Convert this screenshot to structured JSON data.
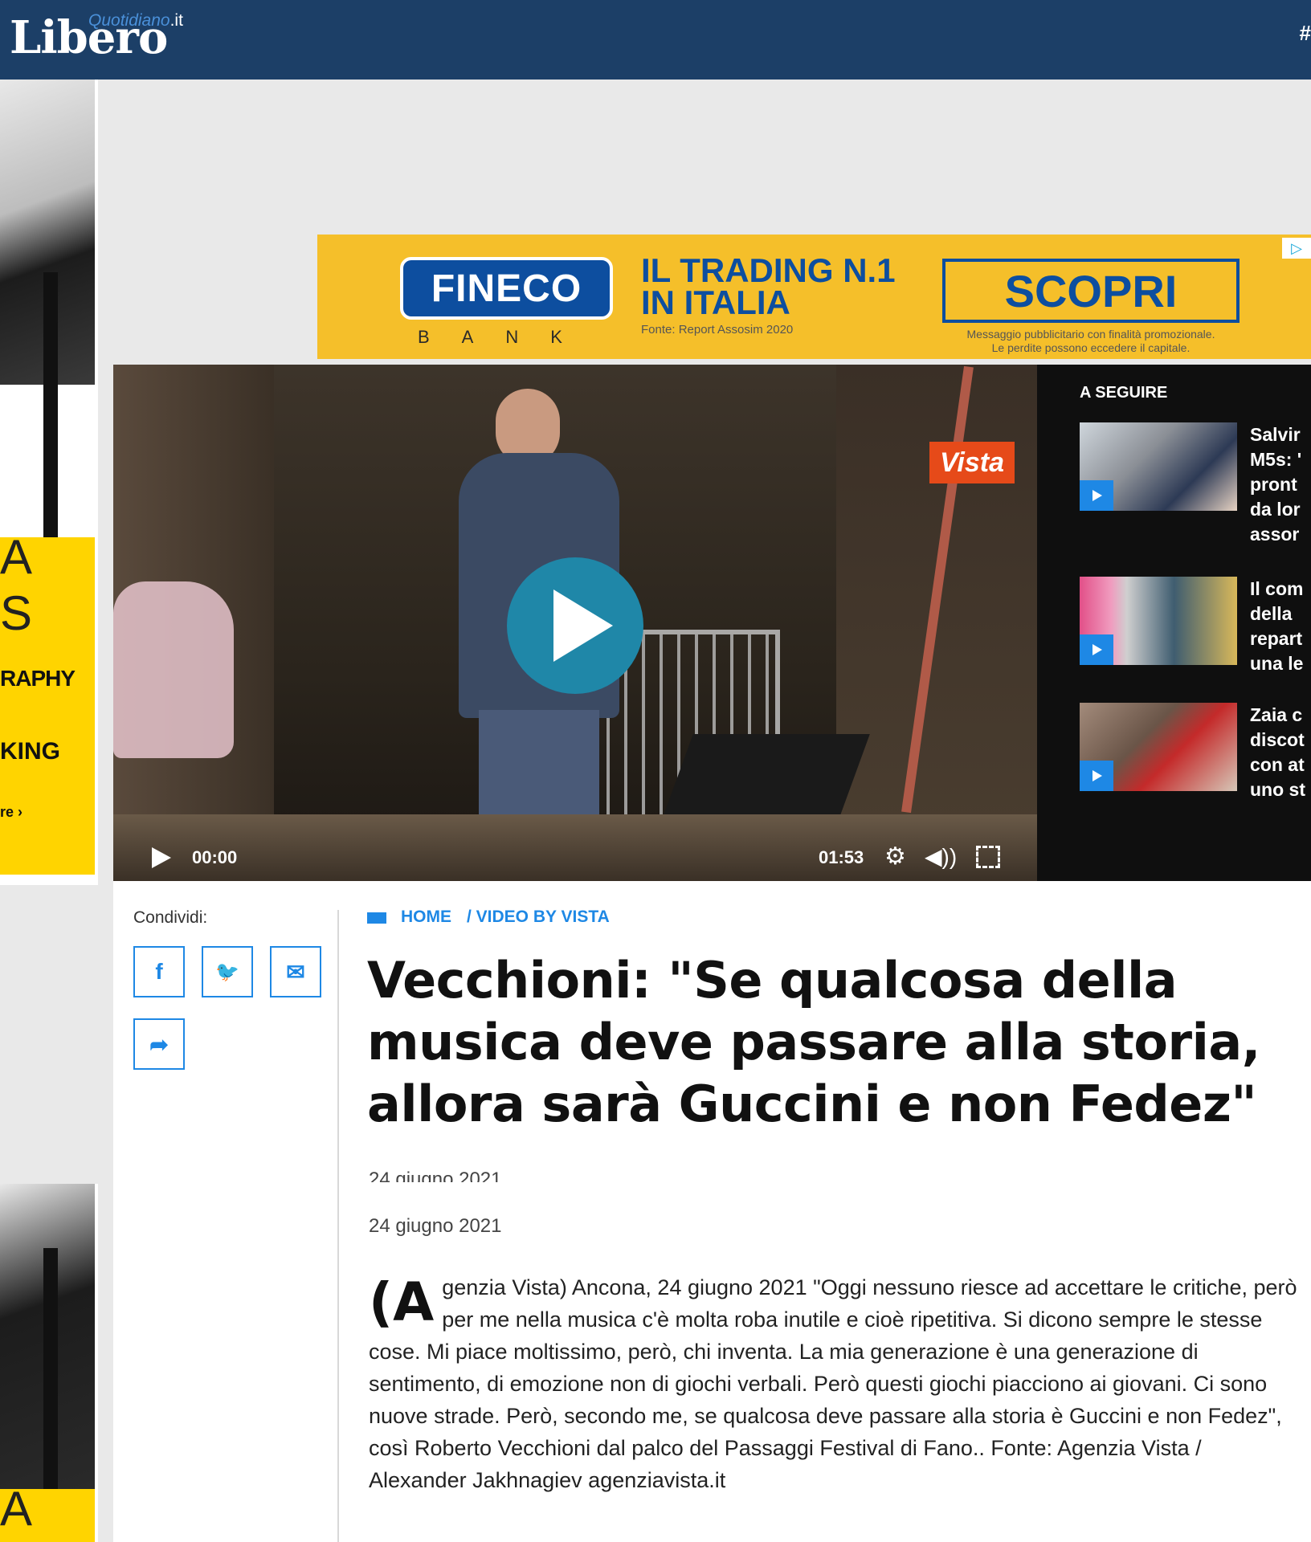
{
  "header": {
    "logo_main": "Libero",
    "logo_sub": "Quotidiano",
    "logo_tld": ".it",
    "right_glyph": "#"
  },
  "left_skin": {
    "letter_a": "A",
    "letter_s": "S",
    "text_graphy": "RAPHY",
    "text_king": "KING",
    "text_more": "re ›"
  },
  "ad": {
    "brand": "FINECO",
    "brand_sub": "BANK",
    "headline_1": "IL TRADING N.1",
    "headline_2": "IN ITALIA",
    "source": "Fonte: Report Assosim 2020",
    "cta": "SCOPRI",
    "disclaimer_1": "Messaggio pubblicitario con finalità promozionale.",
    "disclaimer_2": "Le perdite possono eccedere il capitale.",
    "adchoices_icon": "adchoices-icon"
  },
  "video": {
    "watermark": "Vista",
    "current_time": "00:00",
    "duration": "01:53",
    "settings_icon": "gear-icon",
    "volume_icon": "volume-icon",
    "fullscreen_icon": "fullscreen-icon"
  },
  "up_next": {
    "title": "A SEGUIRE",
    "items": [
      {
        "text": "Salvir\nM5s: '\npront\nda lor\nassor"
      },
      {
        "text": "Il com\ndella \nrepart\nuna le"
      },
      {
        "text": "Zaia c\ndiscot\ncon at\nuno st"
      }
    ]
  },
  "share": {
    "label": "Condividi:",
    "facebook": "f",
    "twitter": "🐦",
    "email": "✉",
    "more": "➦"
  },
  "breadcrumb": {
    "home": "HOME",
    "section": "/ VIDEO BY VISTA"
  },
  "article": {
    "title": "Vecchioni: \"Se qualcosa della musica deve passare alla storia, allora sarà Guccini e non Fedez\"",
    "date_ghost": "24 giugno 2021",
    "date": "24 giugno 2021",
    "dropcap": "(A",
    "body": "genzia Vista) Ancona, 24 giugno 2021 \"Oggi nessuno riesce ad accettare le critiche, però per me nella musica c'è molta roba inutile e cioè ripetitiva. Si dicono sempre le stesse cose. Mi piace moltissimo, però, chi inventa. La mia generazione è una generazione di sentimento, di emozione non di giochi verbali. Però questi giochi piacciono ai giovani. Ci sono nuove strade. Però, secondo me, se qualcosa deve passare alla storia è Guccini e non Fedez\", così Roberto Vecchioni dal palco del Passaggi Festival di Fano.. Fonte: Agenzia Vista / Alexander Jakhnagiev agenziavista.it"
  }
}
